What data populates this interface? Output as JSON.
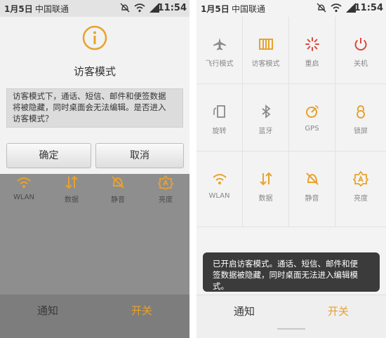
{
  "status": {
    "date": "1月5日",
    "carrier": "中国联通",
    "time": "11:54"
  },
  "dialog": {
    "title": "访客模式",
    "message_lines": [
      "访客模式下，通话、短信、邮件和便签数据",
      "将被隐藏，同时桌面会无法编辑。是否进入",
      "访客模式？"
    ],
    "confirm": "确定",
    "cancel": "取消"
  },
  "dim_tiles": [
    {
      "label": "WLAN",
      "icon": "wifi-icon"
    },
    {
      "label": "数据",
      "icon": "data-icon"
    },
    {
      "label": "静音",
      "icon": "mute-icon"
    },
    {
      "label": "亮度",
      "icon": "brightness-icon"
    }
  ],
  "toggles": [
    {
      "label": "飞行模式",
      "icon": "airplane-icon"
    },
    {
      "label": "访客模式",
      "icon": "guest-mode-icon"
    },
    {
      "label": "重启",
      "icon": "reboot-icon"
    },
    {
      "label": "关机",
      "icon": "power-icon"
    },
    {
      "label": "旋转",
      "icon": "rotate-icon"
    },
    {
      "label": "蓝牙",
      "icon": "bluetooth-icon"
    },
    {
      "label": "GPS",
      "icon": "gps-icon"
    },
    {
      "label": "锁屏",
      "icon": "lock-icon"
    },
    {
      "label": "WLAN",
      "icon": "wifi-icon"
    },
    {
      "label": "数据",
      "icon": "data-icon"
    },
    {
      "label": "静音",
      "icon": "mute-icon"
    },
    {
      "label": "亮度",
      "icon": "brightness-icon"
    }
  ],
  "toast_lines": [
    "已开启访客模式。通话、短信、邮件和便",
    "签数据被隐藏，同时桌面无法进入编辑模",
    "式。"
  ],
  "tabs": {
    "notify": "通知",
    "switch": "开关"
  },
  "colors": {
    "accent": "#e8a22c",
    "icon_gray": "#8a8a8a",
    "power_red": "#d94b3a"
  }
}
